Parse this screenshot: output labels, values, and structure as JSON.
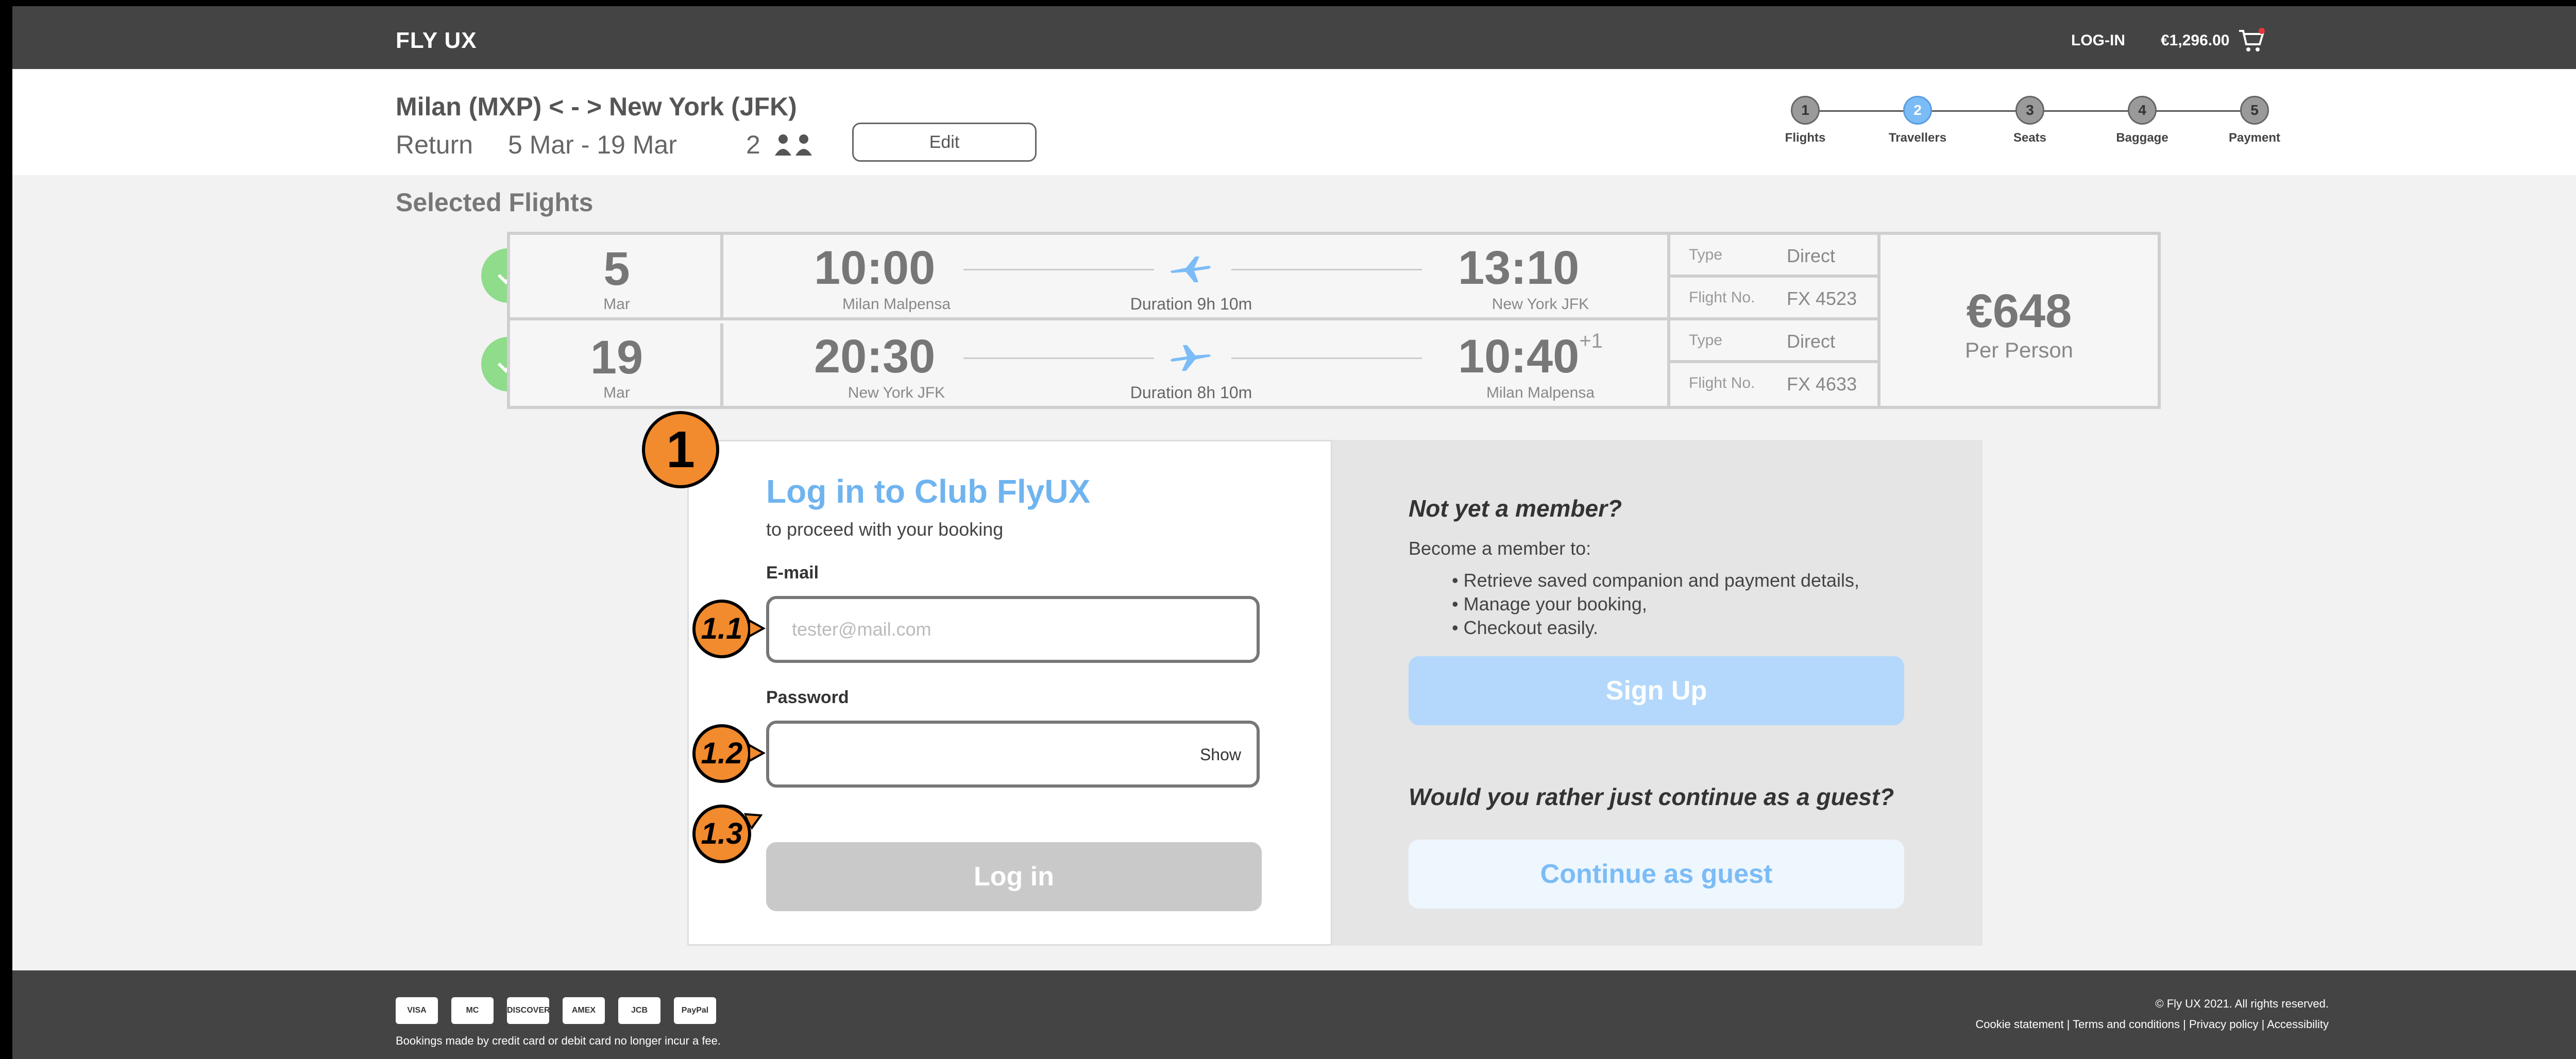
{
  "header": {
    "logo": "FLY UX",
    "login_label": "LOG-IN",
    "cart_total": "€1,296.00"
  },
  "trip": {
    "route": "Milan (MXP) < - > New York (JFK)",
    "type": "Return",
    "dates": "5 Mar - 19 Mar",
    "passengers": "2",
    "edit_label": "Edit"
  },
  "stepper": {
    "active_step": 2,
    "steps": [
      {
        "num": "1",
        "label": "Flights"
      },
      {
        "num": "2",
        "label": "Travellers"
      },
      {
        "num": "3",
        "label": "Seats"
      },
      {
        "num": "4",
        "label": "Baggage"
      },
      {
        "num": "5",
        "label": "Payment"
      }
    ]
  },
  "selected_flights": {
    "title": "Selected Flights",
    "flights": [
      {
        "day": "5",
        "month": "Mar",
        "depart_time": "10:00",
        "depart_airport": "Milan Malpensa",
        "duration": "Duration 9h 10m",
        "arrive_time": "13:10",
        "arrive_offset": "",
        "arrive_airport": "New York JFK",
        "type_label": "Type",
        "type_value": "Direct",
        "flight_no_label": "Flight No.",
        "flight_no": "FX 4523"
      },
      {
        "day": "19",
        "month": "Mar",
        "depart_time": "20:30",
        "depart_airport": "New York JFK",
        "duration": "Duration 8h 10m",
        "arrive_time": "10:40",
        "arrive_offset": "+1",
        "arrive_airport": "Milan Malpensa",
        "type_label": "Type",
        "type_value": "Direct",
        "flight_no_label": "Flight No.",
        "flight_no": "FX 4633"
      }
    ],
    "price": "€648",
    "price_note": "Per Person"
  },
  "login": {
    "title": "Log in to Club FlyUX",
    "subtitle": "to proceed with your booking",
    "email_label": "E-mail",
    "email_placeholder": "tester@mail.com",
    "email_value": "",
    "password_label": "Password",
    "password_value": "",
    "show_label": "Show",
    "login_button": "Log in"
  },
  "member": {
    "heading": "Not yet a member?",
    "intro": "Become a member to:",
    "benefits": [
      "• Retrieve saved companion and payment details,",
      "• Manage your booking,",
      "• Checkout easily."
    ],
    "signup_button": "Sign Up",
    "guest_heading": "Would you rather just continue as a guest?",
    "guest_button": "Continue as guest"
  },
  "annotations": {
    "main": "1",
    "email": "1.1",
    "password": "1.2",
    "login": "1.3"
  },
  "footer": {
    "cards": [
      "VISA",
      "MC",
      "DISCOVER",
      "AMEX",
      "JCB",
      "PayPal"
    ],
    "note": "Bookings made by credit card or debit card no longer incur a fee.",
    "copyright": "© Fly UX 2021. All rights reserved.",
    "links": "Cookie statement | Terms and conditions | Privacy policy | Accessibility"
  },
  "colors": {
    "topbar": "#444444",
    "accent": "#6fb4ef",
    "success": "#8fdc8a",
    "annotation": "#f28a2e"
  }
}
